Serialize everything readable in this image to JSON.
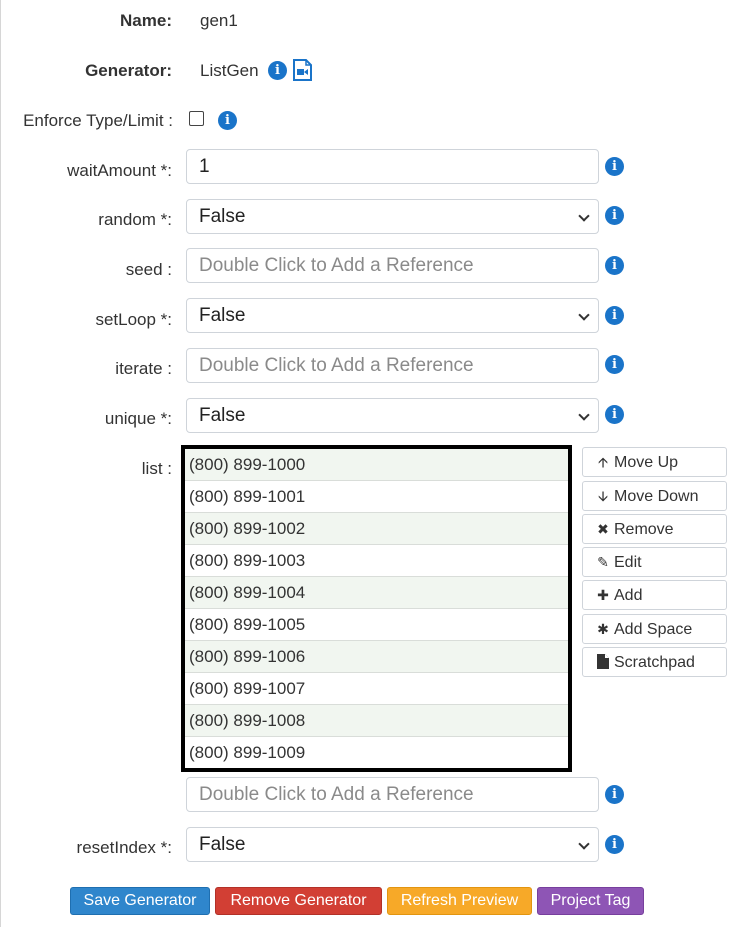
{
  "form": {
    "name_label": "Name:",
    "name_value": "gen1",
    "generator_label": "Generator:",
    "generator_value": "ListGen",
    "enforce_label": "Enforce Type/Limit :",
    "enforce_checked": false,
    "wait_label": "waitAmount *:",
    "wait_value": "1",
    "random_label": "random *:",
    "random_value": "False",
    "seed_label": "seed :",
    "seed_placeholder": "Double Click to Add a Reference",
    "setloop_label": "setLoop *:",
    "setloop_value": "False",
    "iterate_label": "iterate :",
    "iterate_placeholder": "Double Click to Add a Reference",
    "unique_label": "unique *:",
    "unique_value": "False",
    "list_label": "list :",
    "list_ref_placeholder": "Double Click to Add a Reference",
    "reset_label": "resetIndex *:",
    "reset_value": "False"
  },
  "list_items": [
    "(800) 899-1000",
    "(800) 899-1001",
    "(800) 899-1002",
    "(800) 899-1003",
    "(800) 899-1004",
    "(800) 899-1005",
    "(800) 899-1006",
    "(800) 899-1007",
    "(800) 899-1008",
    "(800) 899-1009"
  ],
  "list_buttons": {
    "move_up": "Move Up",
    "move_down": "Move Down",
    "remove": "Remove",
    "edit": "Edit",
    "add": "Add",
    "add_space": "Add Space",
    "scratchpad": "Scratchpad"
  },
  "actions": {
    "save": "Save Generator",
    "remove": "Remove Generator",
    "refresh": "Refresh Preview",
    "tag": "Project Tag"
  },
  "icons": {
    "info": "info-circle-icon",
    "video": "video-file-icon",
    "move_up": "arrow-up-icon",
    "move_down": "arrow-down-icon",
    "remove": "times-icon",
    "edit": "pencil-icon",
    "add": "plus-icon",
    "add_space": "asterisk-icon",
    "scratchpad": "file-icon",
    "dropdown": "chevron-down-icon"
  },
  "colors": {
    "info": "#1a74c9",
    "save": "#2f86cc",
    "remove": "#d23f34",
    "refresh": "#f7a928",
    "tag": "#8e55b5",
    "list_alt_row": "#f1f6f0"
  }
}
